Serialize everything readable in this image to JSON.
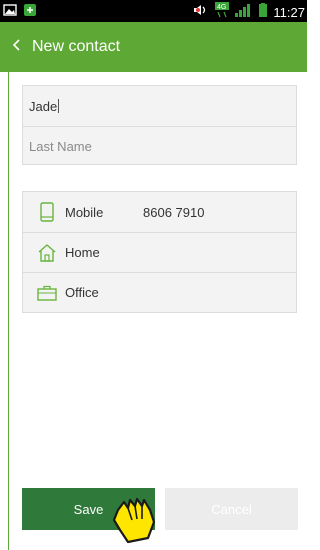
{
  "status_bar": {
    "time": "11:27",
    "network": "4G"
  },
  "app_bar": {
    "back_icon": "chevron-left-icon",
    "title": "New contact"
  },
  "name_fields": {
    "first_name_value": "Jade",
    "last_name_placeholder": "Last Name"
  },
  "phone_fields": [
    {
      "icon": "mobile-phone-icon",
      "label": "Mobile",
      "value": "8606 7910"
    },
    {
      "icon": "home-icon",
      "label": "Home",
      "value": ""
    },
    {
      "icon": "office-briefcase-icon",
      "label": "Office",
      "value": ""
    }
  ],
  "buttons": {
    "save_label": "Save",
    "cancel_label": "Cancel"
  },
  "colors": {
    "accent_green": "#5ea935",
    "save_green": "#2f7a3a",
    "cancel_grey": "#ececec"
  }
}
